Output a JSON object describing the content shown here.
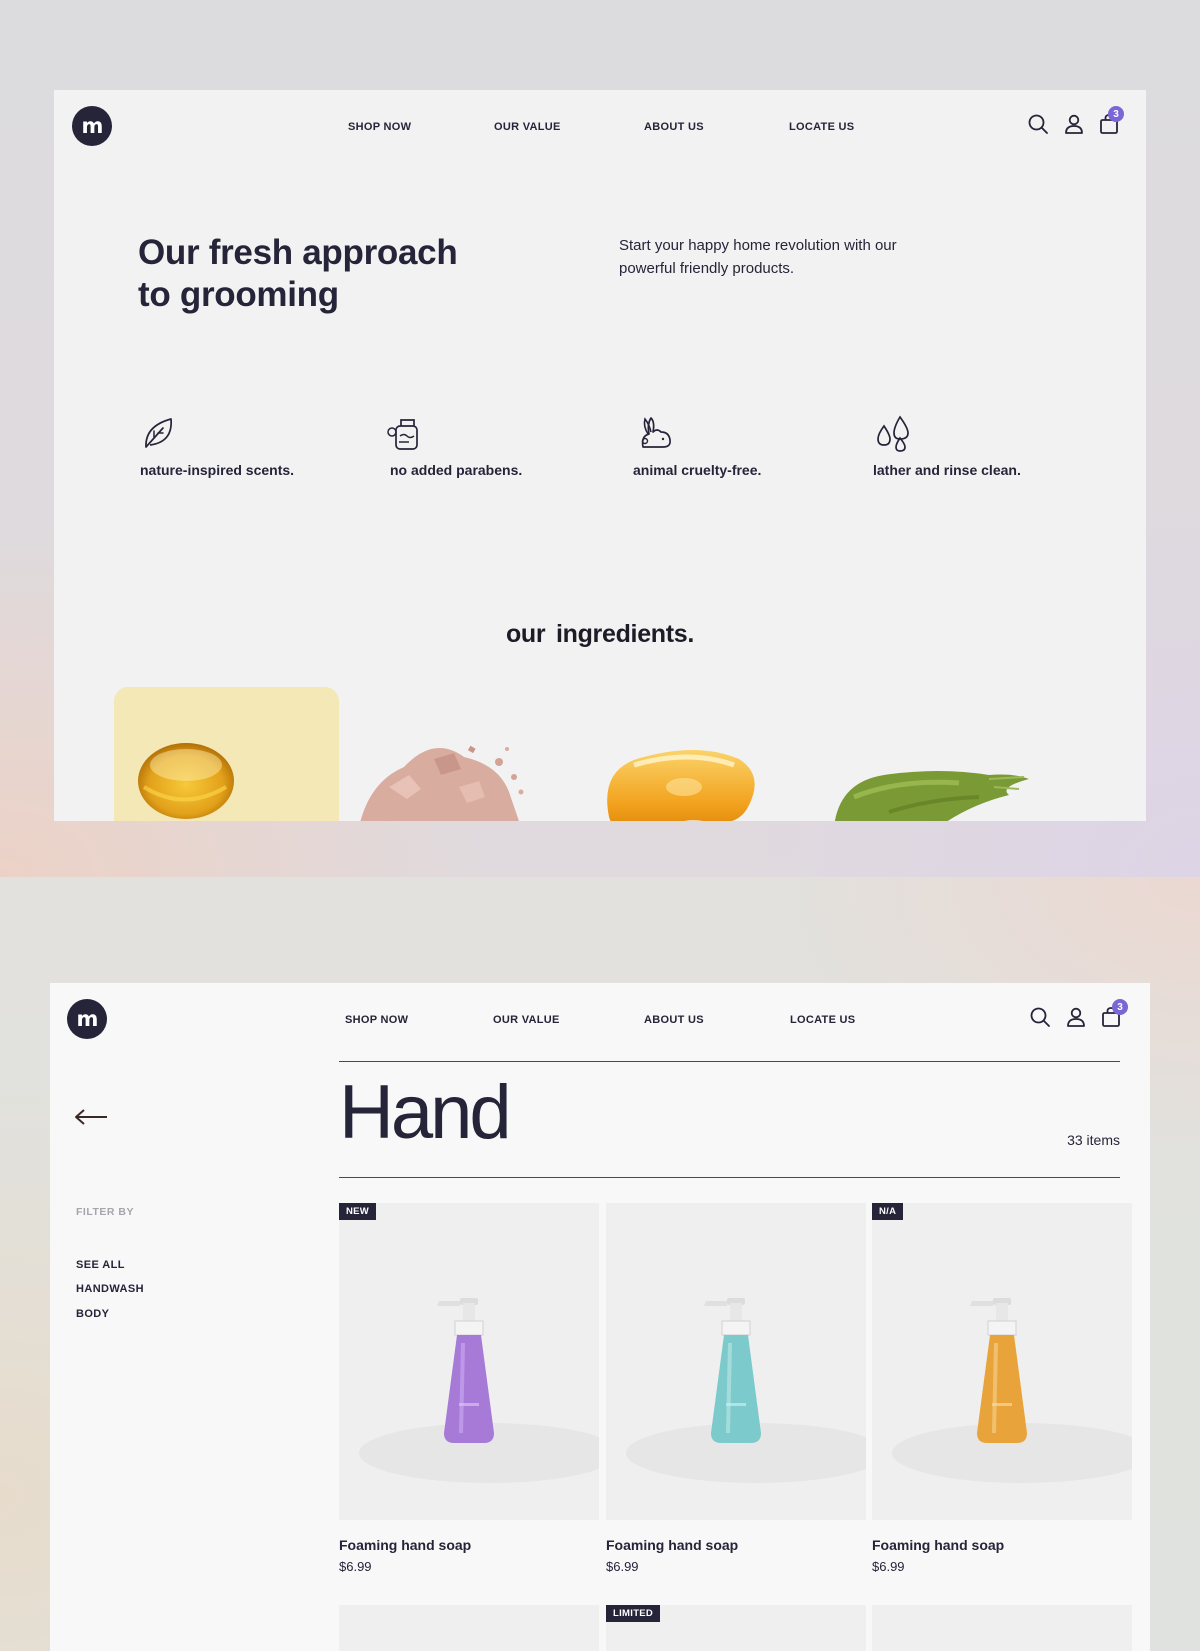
{
  "brand": {
    "logo_text": "m"
  },
  "nav": {
    "items": [
      {
        "label": "SHOP NOW"
      },
      {
        "label": "OUR VALUE"
      },
      {
        "label": "ABOUT US"
      },
      {
        "label": "LOCATE US"
      }
    ],
    "cart_count": "3",
    "icons": [
      "search-icon",
      "account-icon",
      "cart-icon"
    ]
  },
  "hero": {
    "title": "Our fresh approach to grooming",
    "subtitle": "Start your happy home revolution with our powerful friendly products."
  },
  "features": [
    {
      "icon": "leaf-icon",
      "label": "nature-inspired scents."
    },
    {
      "icon": "bottle-icon",
      "label": "no added parabens."
    },
    {
      "icon": "rabbit-icon",
      "label": "animal cruelty-free."
    },
    {
      "icon": "drops-icon",
      "label": "lather and rinse clean."
    }
  ],
  "ingredients": {
    "title": "our  ingredients.",
    "items": [
      "oil-drop",
      "clay-powder",
      "honey",
      "green-paste"
    ],
    "card_highlight_color": "#f3e8b6"
  },
  "category": {
    "title": "Hand",
    "item_count": "33 items",
    "filter_heading": "FILTER BY",
    "filters": [
      "SEE ALL",
      "HANDWASH",
      "BODY"
    ]
  },
  "products": [
    {
      "name": "Foaming hand soap",
      "price": "$6.99",
      "tag": "NEW",
      "color": "#a77ad8"
    },
    {
      "name": "Foaming hand soap",
      "price": "$6.99",
      "tag": "",
      "color": "#7ccacb"
    },
    {
      "name": "Foaming hand soap",
      "price": "$6.99",
      "tag": "N/A",
      "color": "#e8a43a"
    }
  ],
  "next_row": {
    "tag": "LIMITED"
  },
  "colors": {
    "brand_dark": "#262438",
    "accent": "#7b66d6"
  }
}
